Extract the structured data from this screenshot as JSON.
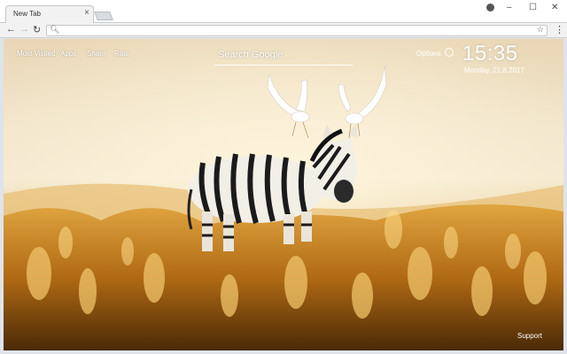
{
  "browser": {
    "tab_title": "New Tab",
    "tab_close": "×",
    "window_controls": {
      "minimize": "–",
      "maximize": "☐",
      "close": "✕"
    },
    "nav": {
      "back": "←",
      "forward": "→",
      "reload": "↻"
    },
    "omnibox_value": "",
    "menu": "⋮"
  },
  "newtab": {
    "links": [
      "Most Visited",
      "Apps",
      "Share",
      "Rate"
    ],
    "search_placeholder": "Search Google",
    "options_label": "Options",
    "time": "15:35",
    "date": "Monday, 21.8.2017",
    "support_label": "Support"
  },
  "icons": {
    "profile": "profile-icon",
    "search": "search-icon",
    "star": "bookmark-star-icon",
    "clock": "clock-icon"
  }
}
